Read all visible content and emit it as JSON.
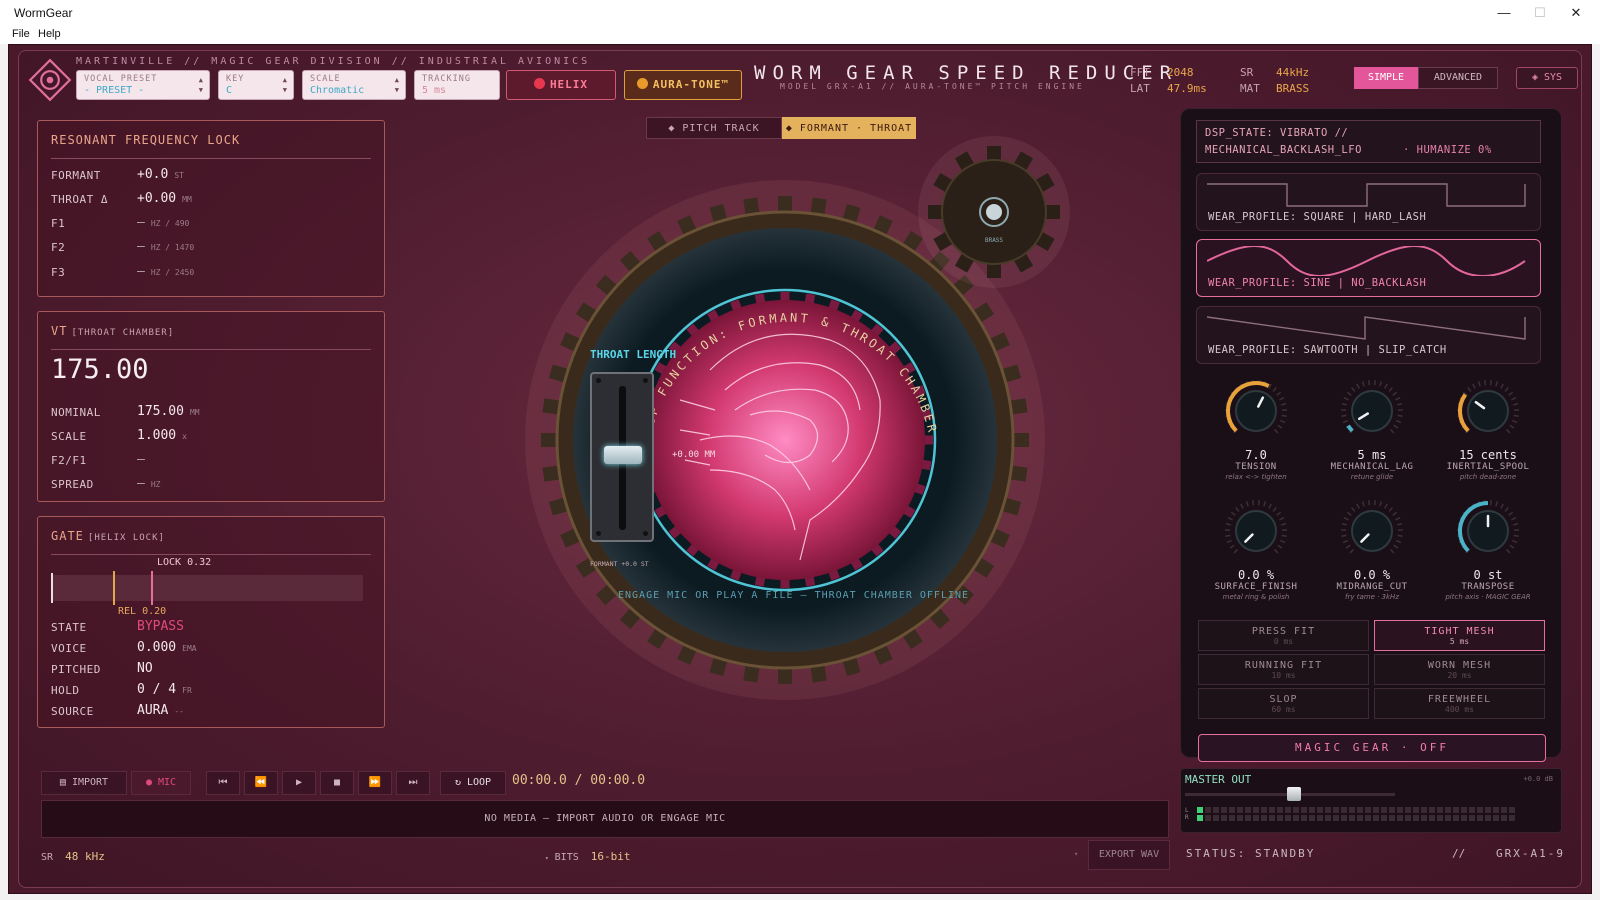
{
  "window": {
    "title": "WormGear",
    "minimize": "—",
    "maximize": "☐",
    "close": "✕"
  },
  "menu": [
    "File",
    "Help"
  ],
  "header": {
    "brand_line": "MARTINVILLE // MAGIC GEAR DIVISION // INDUSTRIAL AVIONICS",
    "title": "WORM GEAR SPEED REDUCER",
    "subtitle": "MODEL GRX-A1 // AURA-TONE™ PITCH ENGINE",
    "selects": [
      {
        "label": "VOCAL PRESET",
        "value": "- PRESET -"
      },
      {
        "label": "KEY",
        "value": "C"
      },
      {
        "label": "SCALE",
        "value": "Chromatic"
      },
      {
        "label": "TRACKING",
        "value": "5 ms"
      }
    ],
    "helix_label": "HELIX",
    "auratone_label": "AURA-TONE™",
    "stats": [
      {
        "key": "FFT",
        "value": "2048"
      },
      {
        "key": "LAT",
        "value": "47.9ms"
      },
      {
        "key": "SR",
        "value": "44kHz"
      },
      {
        "key": "MAT",
        "value": "BRASS"
      }
    ],
    "mode_simple": "SIMPLE",
    "mode_advanced": "ADVANCED",
    "sys_label": "◈ SYS"
  },
  "resonant": {
    "title": "RESONANT FREQUENCY LOCK",
    "rows": [
      {
        "k": "FORMANT",
        "v": "+0.0",
        "u": "ST"
      },
      {
        "k": "THROAT Δ",
        "v": "+0.00",
        "u": "MM"
      },
      {
        "k": "F1",
        "v": "—",
        "u": "HZ / 490"
      },
      {
        "k": "F2",
        "v": "—",
        "u": "HZ / 1470"
      },
      {
        "k": "F3",
        "v": "—",
        "u": "HZ / 2450"
      }
    ]
  },
  "vt": {
    "title": "VT",
    "tag": "[THROAT CHAMBER]",
    "big_value": "175.00",
    "rows": [
      {
        "k": "NOMINAL",
        "v": "175.00",
        "u": "MM"
      },
      {
        "k": "SCALE",
        "v": "1.000",
        "u": "x"
      },
      {
        "k": "F2/F1",
        "v": "—",
        "u": ""
      },
      {
        "k": "SPREAD",
        "v": "—",
        "u": "HZ"
      }
    ]
  },
  "gate": {
    "title": "GATE",
    "tag": "[HELIX LOCK]",
    "lock_label": "LOCK 0.32",
    "rel_label": "REL 0.20",
    "lock_level": 0.32,
    "rel_level": 0.2,
    "rows": [
      {
        "k": "STATE",
        "v": "BYPASS",
        "u": ""
      },
      {
        "k": "VOICE",
        "v": "0.000",
        "u": "EMA"
      },
      {
        "k": "PITCHED",
        "v": "NO",
        "u": ""
      },
      {
        "k": "HOLD",
        "v": "0 / 4",
        "u": "FR"
      },
      {
        "k": "SOURCE",
        "v": "AURA",
        "u": "--"
      }
    ]
  },
  "center": {
    "tab_pitch": "◆ PITCH TRACK",
    "tab_formant": "◆ FORMANT · THROAT",
    "ring_text": "DSP FUNCTION: FORMANT & THROAT CHAMBER",
    "throat_label": "THROAT LENGTH",
    "slider_readout": "+0.00 MM",
    "formant_readout": "FORMANT +0.0 ST",
    "offline_text": "ENGAGE MIC OR PLAY A FILE — THROAT CHAMBER OFFLINE",
    "small_gear_label": "BRASS"
  },
  "right": {
    "dsp_state_1": "DSP_STATE: VIBRATO //",
    "dsp_state_2": "MECHANICAL_BACKLASH_LFO",
    "humanize": "· HUMANIZE 0%",
    "wear_profiles": [
      {
        "label": "WEAR_PROFILE: SQUARE   |   HARD_LASH",
        "shape": "square",
        "active": false
      },
      {
        "label": "WEAR_PROFILE: SINE   |   NO_BACKLASH",
        "shape": "sine",
        "active": true
      },
      {
        "label": "WEAR_PROFILE: SAWTOOTH   |   SLIP_CATCH",
        "shape": "sawtooth",
        "active": false
      }
    ],
    "knobs": [
      {
        "value": "7.0",
        "name": "TENSION",
        "hint": "relax <-> tighten",
        "accent": "#e9a23b",
        "level": 0.6
      },
      {
        "value": "5 ms",
        "name": "MECHANICAL_LAG",
        "hint": "retune glide",
        "accent": "#4bb3c8",
        "level": 0.05
      },
      {
        "value": "15 cents",
        "name": "INERTIAL_SPOOL",
        "hint": "pitch dead-zone",
        "accent": "#e9a23b",
        "level": 0.3
      },
      {
        "value": "0.0 %",
        "name": "SURFACE_FINISH",
        "hint": "metal ring & polish",
        "accent": "#4bb3c8",
        "level": 0.0
      },
      {
        "value": "0.0 %",
        "name": "MIDRANGE_CUT",
        "hint": "fry tame · 3kHz",
        "accent": "#4bb3c8",
        "level": 0.0
      },
      {
        "value": "0 st",
        "name": "TRANSPOSE",
        "hint": "pitch axis · MAGIC GEAR",
        "accent": "#4bb3c8",
        "level": 0.5
      }
    ],
    "fits": [
      {
        "name": "PRESS FIT",
        "time": "0 ms",
        "active": false
      },
      {
        "name": "TIGHT MESH",
        "time": "5 ms",
        "active": true
      },
      {
        "name": "RUNNING FIT",
        "time": "10 ms",
        "active": false
      },
      {
        "name": "WORN MESH",
        "time": "20 ms",
        "active": false
      },
      {
        "name": "SLOP",
        "time": "60 ms",
        "active": false
      },
      {
        "name": "FREEWHEEL",
        "time": "400 ms",
        "active": false
      }
    ],
    "magic_gear": "MAGIC GEAR · OFF"
  },
  "transport": {
    "import": "▤ IMPORT",
    "mic": "● MIC",
    "loop": "↻ LOOP",
    "time": "00:00.0 / 00:00.0",
    "media_empty": "NO MEDIA — IMPORT AUDIO OR ENGAGE MIC",
    "sr_key": "SR",
    "sr_value": "48 kHz",
    "bits_key": "BITS",
    "bits_value": "16-bit",
    "export": "EXPORT WAV"
  },
  "master": {
    "title": "MASTER OUT",
    "db": "+0.0 dB",
    "level": 0.52,
    "meter_l": "L",
    "meter_r": "R"
  },
  "status": {
    "text": "STATUS: STANDBY",
    "sep": "//",
    "code": "GRX-A1-9"
  }
}
